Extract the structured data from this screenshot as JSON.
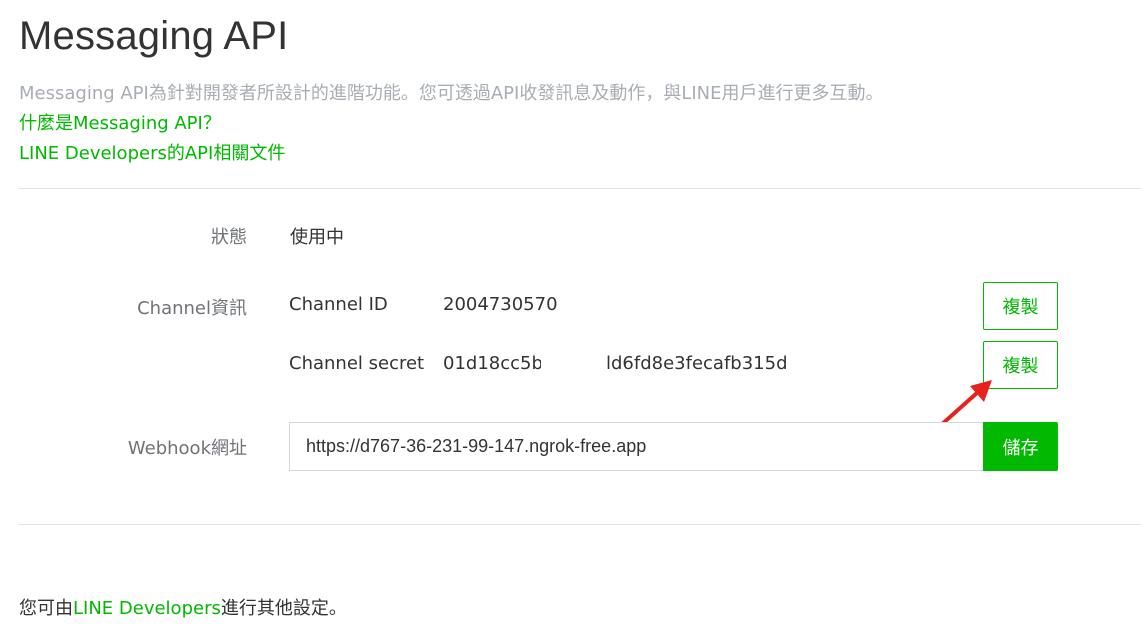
{
  "header": {
    "title": "Messaging API",
    "description": "Messaging API為針對開發者所設計的進階功能。您可透過API收發訊息及動作，與LINE用戶進行更多互動。",
    "links": [
      "什麼是Messaging API？",
      "LINE Developers的API相關文件"
    ]
  },
  "status": {
    "label": "狀態",
    "value": "使用中"
  },
  "channel": {
    "label": "Channel資訊",
    "id_label": "Channel ID",
    "id_value": "2004730570",
    "secret_label": "Channel secret",
    "secret_value_start": "01d18cc5b",
    "secret_value_end": "ld6fd8e3fecafb315d",
    "copy_label": "複製"
  },
  "webhook": {
    "label": "Webhook網址",
    "value": "https://d767-36-231-99-147.ngrok-free.app",
    "save_label": "儲存"
  },
  "footer": {
    "prefix": "您可由",
    "link": "LINE Developers",
    "suffix": "進行其他設定。"
  },
  "colors": {
    "accent": "#00b900",
    "annotation_arrow": "#e8211f"
  },
  "annotation": {
    "icon": "red-arrow-icon"
  }
}
